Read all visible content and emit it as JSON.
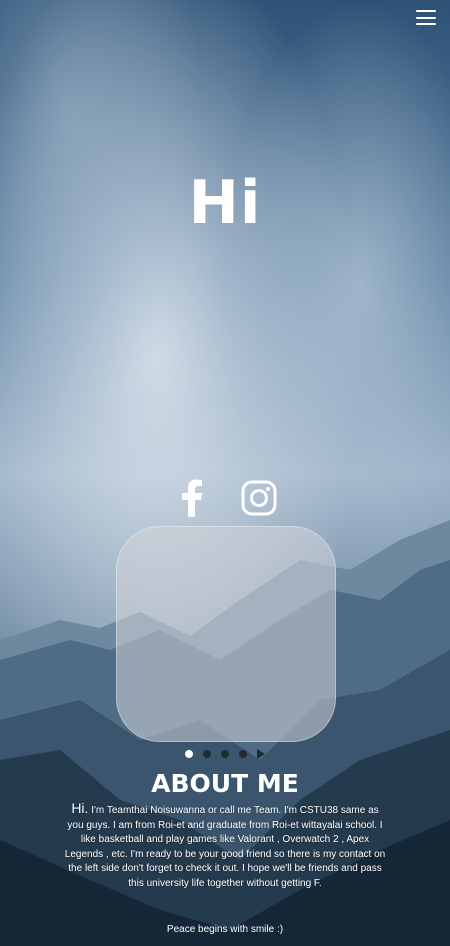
{
  "hero": {
    "title": "Hi"
  },
  "nav": {
    "menu_icon": "hamburger-menu-icon"
  },
  "socials": [
    {
      "name": "facebook",
      "icon": "facebook-icon"
    },
    {
      "name": "instagram",
      "icon": "instagram-icon"
    }
  ],
  "carousel": {
    "slide_count": 4,
    "active_index": 0,
    "control_icon": "play-icon"
  },
  "about": {
    "title": "ABOUT ME",
    "greeting": "Hi.",
    "text": "I'm Teamthai Noisuwanna or call me Team. I'm CSTU38 same as you guys. I am from Roi-et and graduate from Roi-et wittayalai school. I like basketball and play games like Valorant , Overwatch 2 , Apex Legends , etc. I'm ready to be your good friend so there is my contact on the left side don't forget to check it out. I hope we'll be friends and pass this university life together without getting F.",
    "signoff": "Peace begins with smile :)"
  },
  "colors": {
    "text": "#ffffff",
    "dot_inactive": "#202a34",
    "dot_active": "#ffffff"
  }
}
